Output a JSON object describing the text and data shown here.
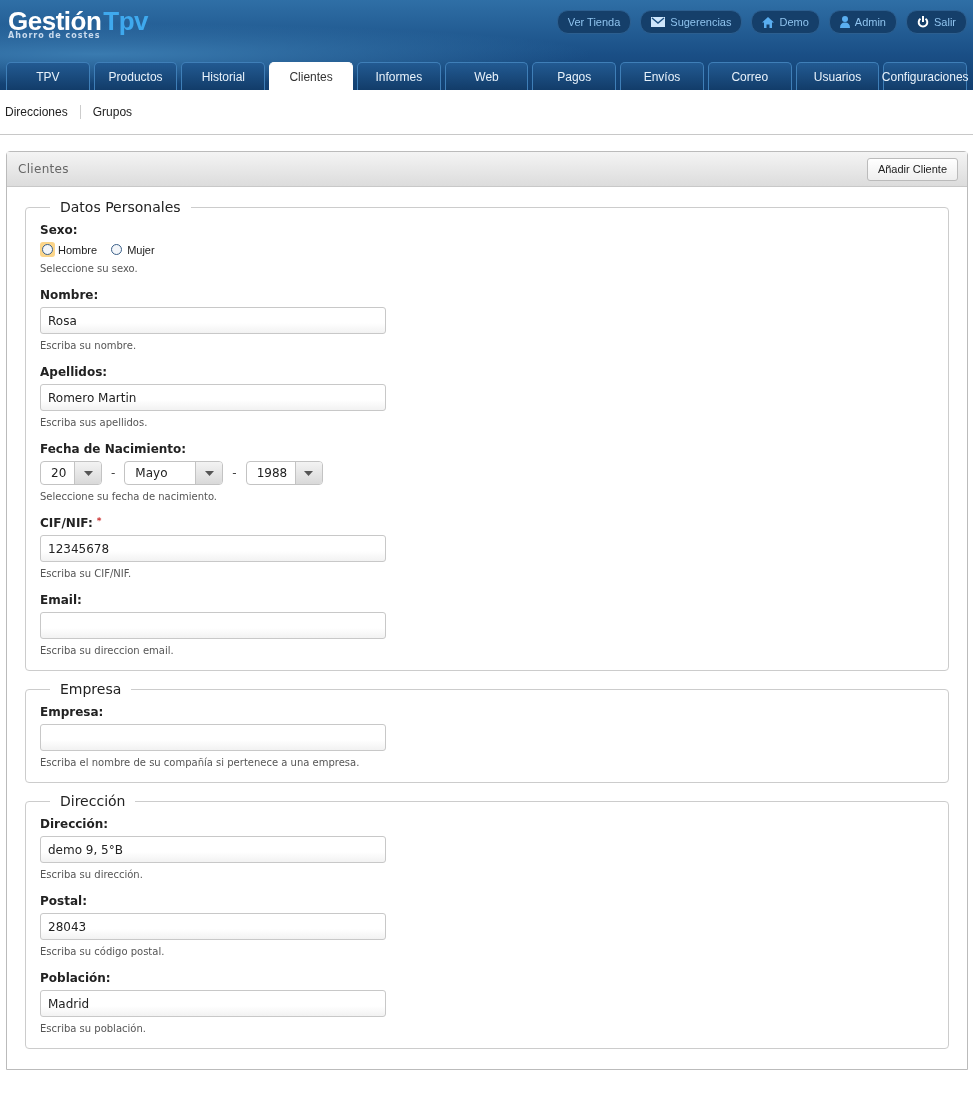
{
  "logo": {
    "name": "Gestión",
    "accent": "Tpv",
    "tagline": "Ahorro de costes"
  },
  "top_links": [
    {
      "label": "Ver Tienda"
    },
    {
      "label": "Sugerencias"
    },
    {
      "label": "Demo"
    },
    {
      "label": "Admin"
    },
    {
      "label": "Salir"
    }
  ],
  "tabs": [
    {
      "label": "TPV",
      "selected": false
    },
    {
      "label": "Productos",
      "selected": false
    },
    {
      "label": "Historial",
      "selected": false
    },
    {
      "label": "Clientes",
      "selected": true
    },
    {
      "label": "Informes",
      "selected": false
    },
    {
      "label": "Web",
      "selected": false
    },
    {
      "label": "Pagos",
      "selected": false
    },
    {
      "label": "Envíos",
      "selected": false
    },
    {
      "label": "Correo",
      "selected": false
    },
    {
      "label": "Usuarios",
      "selected": false
    },
    {
      "label": "Configuraciones",
      "selected": false
    }
  ],
  "subnav": [
    "Direcciones",
    "Grupos"
  ],
  "panel": {
    "title": "Clientes",
    "button": "Añadir Cliente"
  },
  "sections": [
    {
      "legend": "Datos Personales",
      "fields": [
        {
          "kind": "radio",
          "label": "Sexo:",
          "options": [
            {
              "label": "Hombre",
              "selected": false,
              "focused": true
            },
            {
              "label": "Mujer",
              "selected": false,
              "focused": false
            }
          ],
          "help": "Seleccione su sexo."
        },
        {
          "kind": "text",
          "label": "Nombre:",
          "value": "Rosa",
          "help": "Escriba su nombre."
        },
        {
          "kind": "text",
          "label": "Apellidos:",
          "value": "Romero Martin",
          "help": "Escriba sus apellidos."
        },
        {
          "kind": "date",
          "label": "Fecha de Nacimiento:",
          "day": "20",
          "month": "Mayo",
          "year": "1988",
          "separator": "-",
          "help": "Seleccione su fecha de nacimiento."
        },
        {
          "kind": "text",
          "label": "CIF/NIF:",
          "required": true,
          "required_mark": "*",
          "value": "12345678",
          "help": "Escriba su CIF/NIF."
        },
        {
          "kind": "text",
          "label": "Email:",
          "help": "Escriba su direccion email."
        }
      ]
    },
    {
      "legend": "Empresa",
      "fields": [
        {
          "kind": "text",
          "label": "Empresa:",
          "help": "Escriba el nombre de su compañía si pertenece a una empresa."
        }
      ]
    },
    {
      "legend": "Dirección",
      "fields": [
        {
          "kind": "text",
          "label": "Dirección:",
          "value": "demo 9, 5°B",
          "help": "Escriba su dirección."
        },
        {
          "kind": "text",
          "label": "Postal:",
          "value": "28043",
          "help": "Escriba su código postal."
        },
        {
          "kind": "text",
          "label": "Población:",
          "value": "Madrid",
          "help": "Escriba su población."
        }
      ]
    }
  ]
}
